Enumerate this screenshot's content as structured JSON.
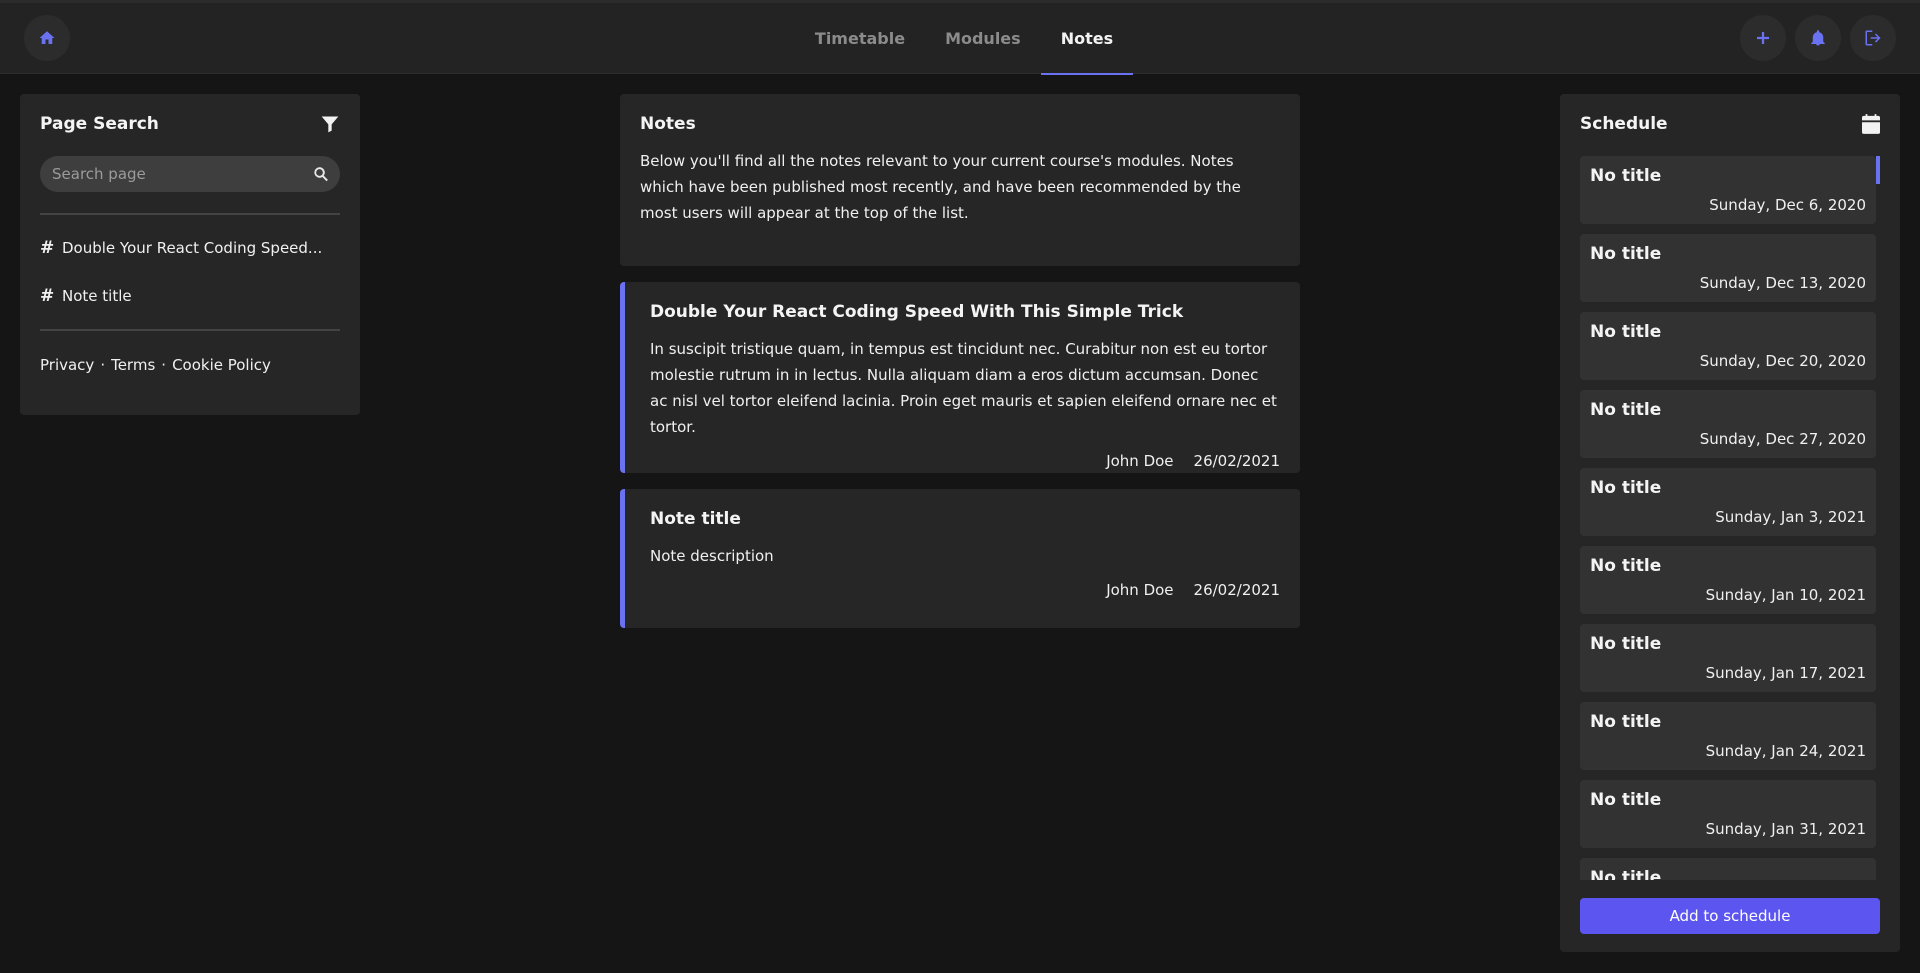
{
  "topbar": {
    "home_icon": "home-icon",
    "tabs": [
      {
        "label": "Timetable",
        "active": false
      },
      {
        "label": "Modules",
        "active": false
      },
      {
        "label": "Notes",
        "active": true
      }
    ],
    "actions": [
      "plus-icon",
      "bell-icon",
      "sign-out-icon"
    ]
  },
  "left_panel": {
    "title": "Page Search",
    "search_placeholder": "Search page",
    "items": [
      {
        "label": "Double Your React Coding Speed..."
      },
      {
        "label": "Note title"
      }
    ],
    "footer": {
      "privacy": "Privacy",
      "sep1": "·",
      "terms": "Terms",
      "sep2": "·",
      "cookie": "Cookie Policy"
    }
  },
  "intro": {
    "title": "Notes",
    "text": "Below you'll find all the notes relevant to your current course's modules. Notes which have been published most recently, and have been recommended by the most users will appear at the top of the list."
  },
  "notes": [
    {
      "title": "Double Your React Coding Speed With This Simple Trick",
      "body": "In suscipit tristique quam, in tempus est tincidunt nec. Curabitur non est eu tortor molestie rutrum in in lectus. Nulla aliquam diam a eros dictum accumsan. Donec ac nisl vel tortor eleifend lacinia. Proin eget mauris et sapien eleifend ornare nec et tortor.",
      "author": "John Doe",
      "date": "26/02/2021"
    },
    {
      "title": "Note title",
      "body": "Note description",
      "author": "John Doe",
      "date": "26/02/2021"
    }
  ],
  "schedule": {
    "title": "Schedule",
    "items": [
      {
        "title": "No title",
        "date": "Sunday, Dec 6, 2020"
      },
      {
        "title": "No title",
        "date": "Sunday, Dec 13, 2020"
      },
      {
        "title": "No title",
        "date": "Sunday, Dec 20, 2020"
      },
      {
        "title": "No title",
        "date": "Sunday, Dec 27, 2020"
      },
      {
        "title": "No title",
        "date": "Sunday, Jan 3, 2021"
      },
      {
        "title": "No title",
        "date": "Sunday, Jan 10, 2021"
      },
      {
        "title": "No title",
        "date": "Sunday, Jan 17, 2021"
      },
      {
        "title": "No title",
        "date": "Sunday, Jan 24, 2021"
      },
      {
        "title": "No title",
        "date": "Sunday, Jan 31, 2021"
      },
      {
        "title": "No title",
        "date": ""
      }
    ],
    "add_button": "Add to schedule"
  },
  "colors": {
    "accent": "#6b72f2",
    "button": "#5c55f0",
    "background": "#151515",
    "panel": "#262626"
  }
}
